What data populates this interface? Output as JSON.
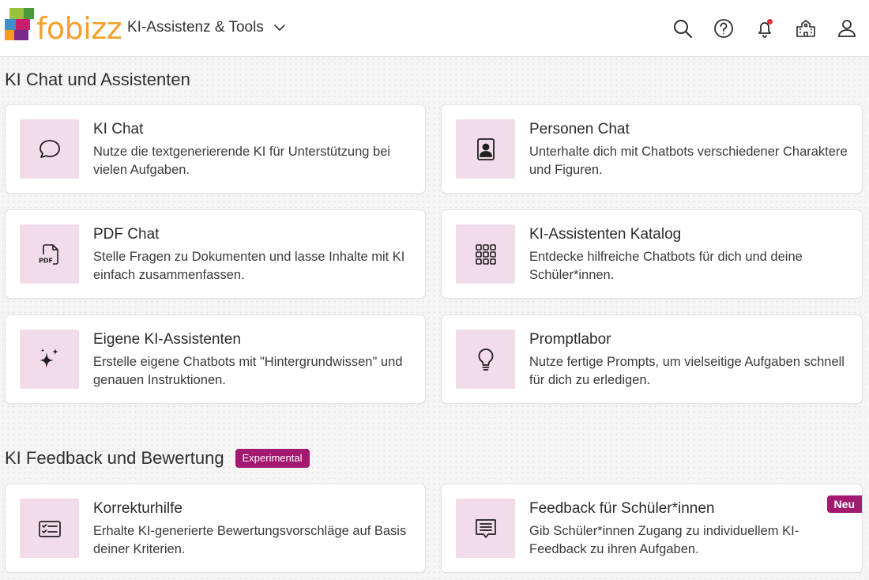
{
  "header": {
    "logo_text": "fobizz",
    "nav_title": "KI-Assistenz & Tools",
    "icons": [
      "search-icon",
      "help-icon",
      "bell-icon",
      "school-icon",
      "user-icon"
    ],
    "notification_color": "#e0303a"
  },
  "sections": [
    {
      "title": "KI Chat und Assistenten",
      "cards": [
        {
          "title": "KI Chat",
          "description": "Nutze die textgenerierende KI für Unterstützung bei vielen Aufgaben.",
          "icon": "chat-bubble-icon"
        },
        {
          "title": "Personen Chat",
          "description": "Unterhalte dich mit Chatbots verschiedener Charaktere und Figuren.",
          "icon": "person-card-icon"
        },
        {
          "title": "PDF Chat",
          "description": "Stelle Fragen zu Dokumenten und lasse Inhalte mit KI einfach zusammenfassen.",
          "icon": "pdf-file-icon",
          "icon_label": "PDF"
        },
        {
          "title": "KI-Assistenten Katalog",
          "description": "Entdecke hilfreiche Chatbots für dich und deine Schüler*innen.",
          "icon": "grid-icon"
        },
        {
          "title": "Eigene KI-Assistenten",
          "description": "Erstelle eigene Chatbots mit \"Hintergrundwissen\" und genauen Instruktionen.",
          "icon": "sparkles-icon"
        },
        {
          "title": "Promptlabor",
          "description": "Nutze fertige Prompts, um vielseitige Aufgaben schnell für dich zu erledigen.",
          "icon": "lightbulb-icon"
        }
      ]
    },
    {
      "title": "KI Feedback und Bewertung",
      "badge": "Experimental",
      "cards": [
        {
          "title": "Korrekturhilfe",
          "description": "Erhalte KI-generierte Bewertungsvorschläge auf Basis deiner Kriterien.",
          "icon": "checklist-icon"
        },
        {
          "title": "Feedback für Schüler*innen",
          "description": "Gib Schüler*innen Zugang zu individuellem KI-Feedback zu ihren Aufgaben.",
          "icon": "feedback-message-icon",
          "badge": "Neu"
        }
      ]
    }
  ],
  "colors": {
    "accent": "#a3196f",
    "tile_bg": "#f3dce9",
    "logo_orange": "#f3a12b"
  }
}
